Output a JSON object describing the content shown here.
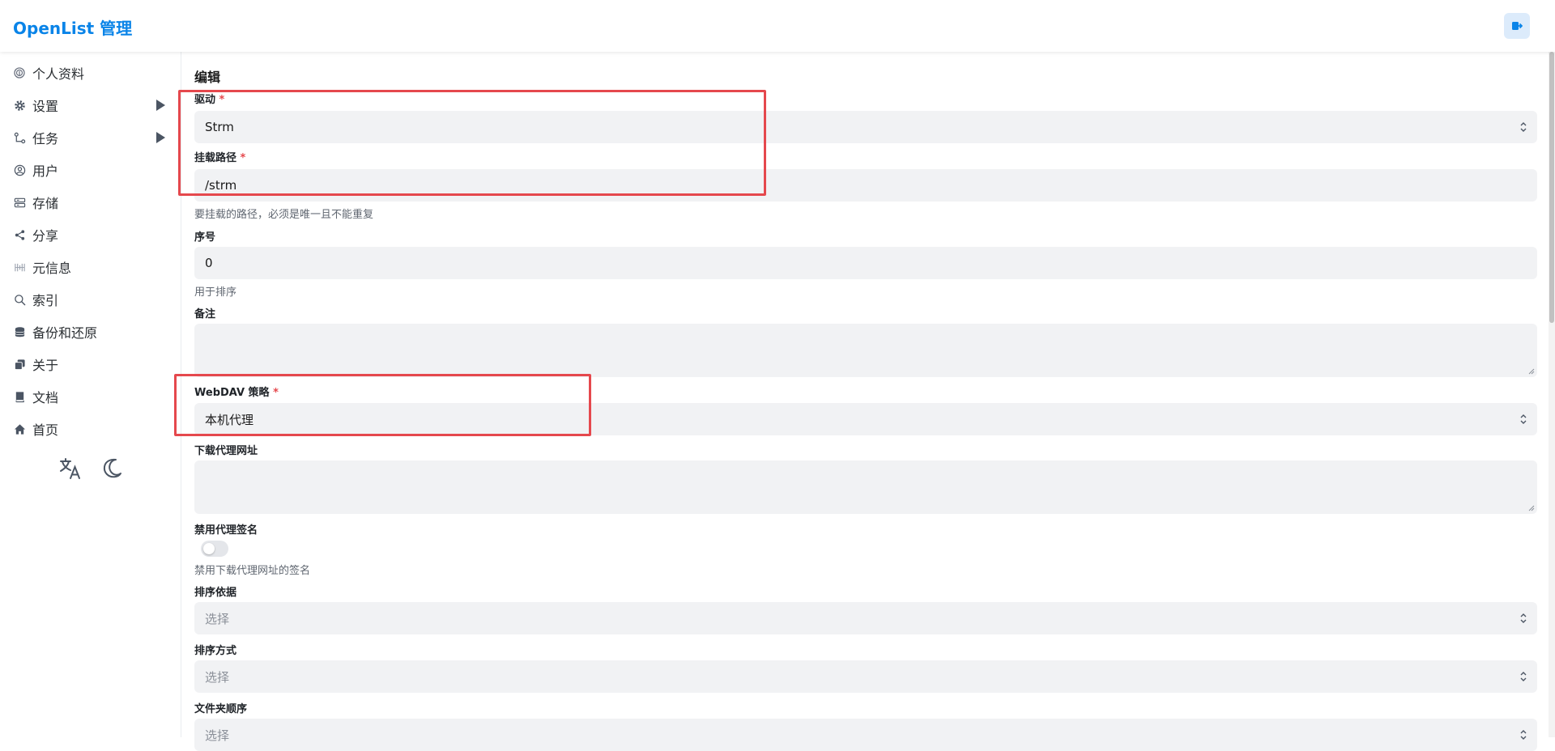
{
  "header": {
    "brand": "OpenList 管理",
    "logout_icon": "logout-icon",
    "accent": "#0a84e8"
  },
  "sidebar": {
    "items": [
      {
        "label": "个人资料",
        "icon": "fingerprint-icon"
      },
      {
        "label": "设置",
        "icon": "gear-icon",
        "expandable": true
      },
      {
        "label": "任务",
        "icon": "tasks-icon",
        "expandable": true
      },
      {
        "label": "用户",
        "icon": "user-icon"
      },
      {
        "label": "存储",
        "icon": "storage-icon"
      },
      {
        "label": "分享",
        "icon": "share-icon"
      },
      {
        "label": "元信息",
        "icon": "meta-icon"
      },
      {
        "label": "索引",
        "icon": "search-icon"
      },
      {
        "label": "备份和还原",
        "icon": "database-icon"
      },
      {
        "label": "关于",
        "icon": "copy-icon"
      },
      {
        "label": "文档",
        "icon": "book-icon"
      },
      {
        "label": "首页",
        "icon": "home-icon"
      }
    ],
    "tools": [
      "translate-icon",
      "moon-icon"
    ]
  },
  "form": {
    "title": "编辑",
    "required_mark": "*",
    "driver": {
      "label": "驱动",
      "value": "Strm"
    },
    "mount_path": {
      "label": "挂载路径",
      "value": "/strm",
      "help": "要挂载的路径，必须是唯一且不能重复"
    },
    "order": {
      "label": "序号",
      "value": "0",
      "help": "用于排序"
    },
    "remark": {
      "label": "备注",
      "value": ""
    },
    "webdav_policy": {
      "label": "WebDAV 策略",
      "value": "本机代理"
    },
    "down_proxy_url": {
      "label": "下载代理网址",
      "value": ""
    },
    "disable_proxy_sign": {
      "label": "禁用代理签名",
      "value": false,
      "help": "禁用下载代理网址的签名"
    },
    "order_by": {
      "label": "排序依据",
      "placeholder": "选择"
    },
    "order_direction": {
      "label": "排序方式",
      "placeholder": "选择"
    },
    "folder_order": {
      "label": "文件夹顺序",
      "placeholder": "选择"
    }
  },
  "highlight_color": "#e5484d"
}
